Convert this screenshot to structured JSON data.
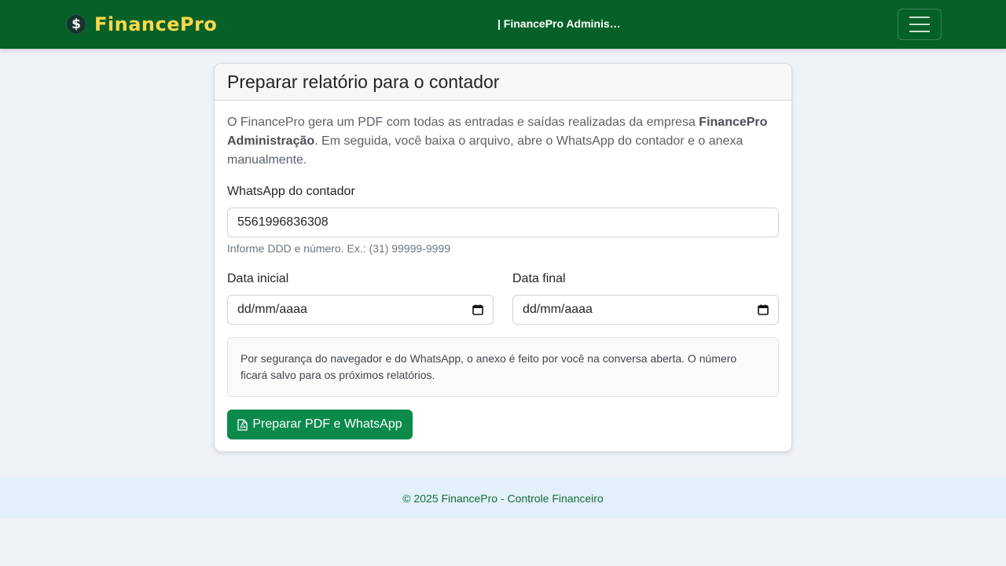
{
  "navbar": {
    "brand_name": "FinancePro",
    "brand_logo_symbol": "$",
    "title": "| FinancePro Administração",
    "menu_icon": "hamburger-icon",
    "background": "#066128",
    "brand_color": "#ffd84a"
  },
  "card": {
    "title": "Preparar relatório para o contador",
    "intro": {
      "part1": "O FinancePro gera um PDF com todas as entradas e saídas realizadas da empresa ",
      "company": "FinancePro Administração",
      "part2": ". Em seguida, você baixa o arquivo, abre o WhatsApp do contador e o anexa manualmente."
    },
    "whatsapp": {
      "label": "WhatsApp do contador",
      "value": "5561996836308",
      "help": "Informe DDD e número. Ex.: (31) 99999-9999"
    },
    "start_date": {
      "label": "Data inicial",
      "placeholder": "dd/mm/aaaa",
      "icon": "calendar-icon"
    },
    "end_date": {
      "label": "Data final",
      "placeholder": "dd/mm/aaaa",
      "icon": "calendar-icon"
    },
    "notice": "Por segurança do navegador e do WhatsApp, o anexo é feito por você na conversa aberta. O número ficará salvo para os próximos relatórios.",
    "submit": {
      "label": "Preparar PDF e WhatsApp",
      "icon": "file-pdf-icon",
      "color": "#0b8a4c"
    }
  },
  "footer": {
    "text": "© 2025 FinancePro - Controle Financeiro"
  }
}
